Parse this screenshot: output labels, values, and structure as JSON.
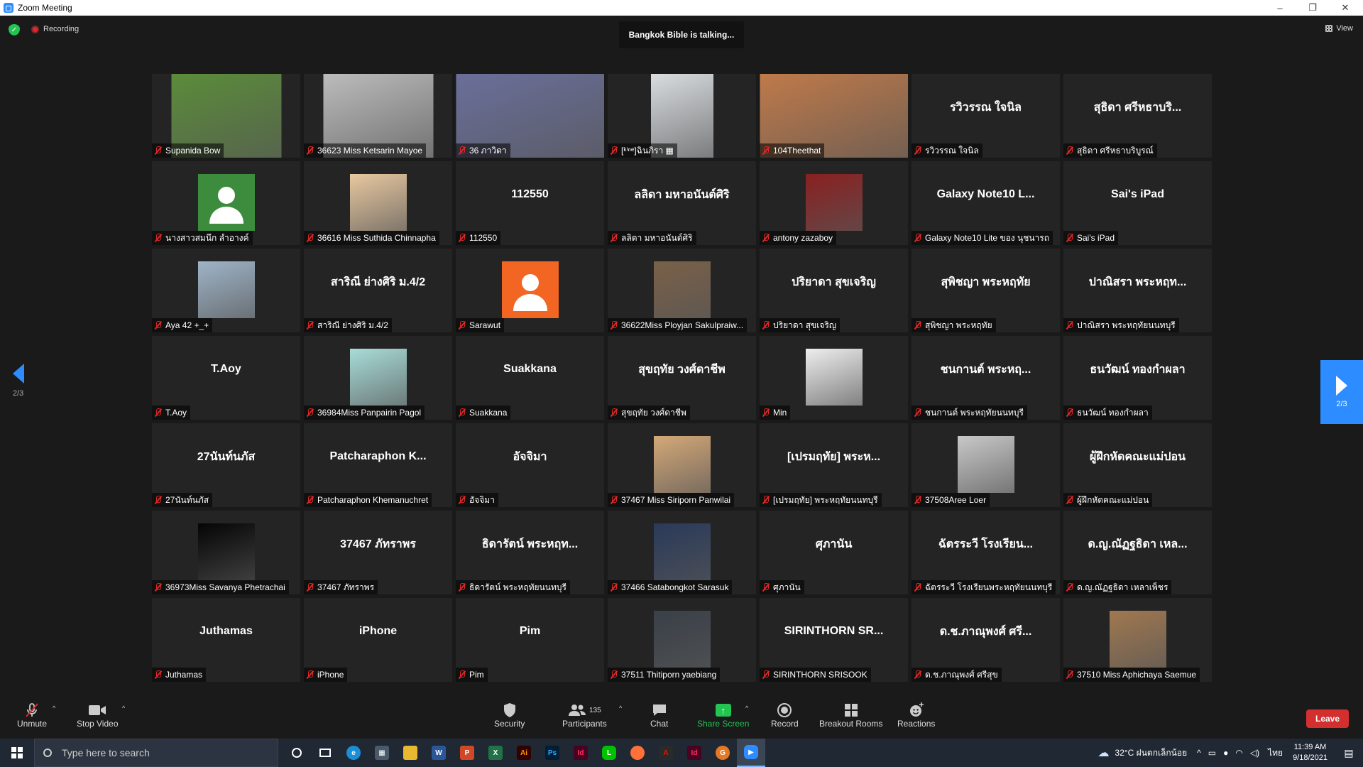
{
  "window": {
    "title": "Zoom Meeting",
    "min": "–",
    "max": "❐",
    "close": "✕"
  },
  "meeting": {
    "recording": "Recording",
    "talking": "Bangkok Bible is talking...",
    "view": "View",
    "page_left": "2/3",
    "page_right": "2/3"
  },
  "tiles": [
    {
      "label": "Supanida Bow",
      "kind": "photo",
      "color": "#5b8c3a"
    },
    {
      "label": "36623 Miss Ketsarin Mayoe",
      "kind": "photo",
      "color": "#bcbcbc"
    },
    {
      "label": "36 ภาวิดา",
      "kind": "photo-wide",
      "color": "#6a6f9a"
    },
    {
      "label": "[ᵏⁱⁿᵉ]ฉินภิรา ▦",
      "kind": "photo-mid",
      "color": "#d9dde0"
    },
    {
      "label": "104Theethat",
      "kind": "photo-wide",
      "color": "#c07a4a"
    },
    {
      "label": "รวิวรรณ ใจนิล",
      "kind": "name",
      "big": "รวิวรรณ ใจนิล"
    },
    {
      "label": "สุธิดา ศรีหธาบริบูรณ์",
      "kind": "name",
      "big": "สุธิดา ศรีหธาบริ..."
    },
    {
      "label": "นางสาวสมนึก ลำอางค์",
      "kind": "avatar",
      "color": "#3d8c3d"
    },
    {
      "label": "36616 Miss Suthida Chinnapha",
      "kind": "photo-sq",
      "color": "#e8c8a0"
    },
    {
      "label": "112550",
      "kind": "name",
      "big": "112550"
    },
    {
      "label": "ลลิดา มหาอนันต์ศิริ",
      "kind": "name",
      "big": "ลลิดา มหาอนันต์ศิริ"
    },
    {
      "label": "antony zazaboy",
      "kind": "photo-sq",
      "color": "#8a2020"
    },
    {
      "label": "Galaxy Note10 Lite ของ นุชนารถ",
      "kind": "name",
      "big": "Galaxy Note10 L..."
    },
    {
      "label": "Sai's iPad",
      "kind": "name",
      "big": "Sai's iPad"
    },
    {
      "label": "Aya 42 +_+",
      "kind": "photo-sq",
      "color": "#9fb4c8"
    },
    {
      "label": "สาริณี ย่างศิริ ม.4/2",
      "kind": "name",
      "big": "สาริณี ย่างศิริ ม.4/2"
    },
    {
      "label": "Sarawut",
      "kind": "avatar",
      "color": "#f26522"
    },
    {
      "label": "36622Miss Ployjan Sakulpraiw...",
      "kind": "photo-sq",
      "color": "#7a6048"
    },
    {
      "label": "ปริยาดา สุขเจริญ",
      "kind": "name",
      "big": "ปริยาดา สุขเจริญ"
    },
    {
      "label": "สุพิชญา พระหฤทัย",
      "kind": "name",
      "big": "สุพิชญา พระหฤทัย"
    },
    {
      "label": "ปาณิสรา พระหฤทัยนนทบุรี",
      "kind": "name",
      "big": "ปาณิสรา พระหฤท..."
    },
    {
      "label": "T.Aoy",
      "kind": "name",
      "big": "T.Aoy"
    },
    {
      "label": "36984Miss Panpairin Pagol",
      "kind": "photo-sq",
      "color": "#a8dcd8"
    },
    {
      "label": "Suakkana",
      "kind": "name",
      "big": "Suakkana"
    },
    {
      "label": "สุขฤทัย วงศ์ดาชีพ",
      "kind": "name",
      "big": "สุขฤทัย วงศ์ดาชีพ"
    },
    {
      "label": "Min",
      "kind": "photo-sq",
      "color": "#eeeeee"
    },
    {
      "label": "ชนกานต์ พระหฤทัยนนทบุรี",
      "kind": "name",
      "big": "ชนกานต์ พระหฤ..."
    },
    {
      "label": "ธนวัฒน์ ทองกำผลา",
      "kind": "name",
      "big": "ธนวัฒน์ ทองกำผลา"
    },
    {
      "label": "27นันท์นภัส",
      "kind": "name",
      "big": "27นันท์นภัส"
    },
    {
      "label": "Patcharaphon Khemanuchret",
      "kind": "name",
      "big": "Patcharaphon K..."
    },
    {
      "label": "อัจจิมา",
      "kind": "name",
      "big": "อัจจิมา"
    },
    {
      "label": "37467 Miss Siriporn Panwilai",
      "kind": "photo-sq",
      "color": "#d4a878"
    },
    {
      "label": "[เปรมฤทัย] พระหฤทัยนนทบุรี",
      "kind": "name",
      "big": "[เปรมฤทัย] พระห..."
    },
    {
      "label": "37508Aree Loer",
      "kind": "photo-sq",
      "color": "#c8c8c8"
    },
    {
      "label": "ผู้ฝึกหัดคณะแม่ปอน",
      "kind": "name",
      "big": "ผู้ฝึกหัดคณะแม่ปอน"
    },
    {
      "label": "36973Miss Savanya Phetrachai",
      "kind": "photo-sq",
      "color": "#050505"
    },
    {
      "label": "37467 ภัทราพร",
      "kind": "name",
      "big": "37467 ภัทราพร"
    },
    {
      "label": "ธิดารัตน์ พระหฤทัยนนทบุรี",
      "kind": "name",
      "big": "ธิดารัตน์ พระหฤท..."
    },
    {
      "label": "37466 Satabongkot Sarasuk",
      "kind": "photo-sq",
      "color": "#2a3a5a"
    },
    {
      "label": "ศุภานัน",
      "kind": "name",
      "big": "ศุภานัน"
    },
    {
      "label": "ฉัตรระวี โรงเรียนพระหฤทัยนนทบุรี",
      "kind": "name",
      "big": "ฉัตรระวี โรงเรียน..."
    },
    {
      "label": "ด.ญ.ณัฏฐธิดา เหลาเพ็ชร",
      "kind": "name",
      "big": "ด.ญ.ณัฏฐธิดา เหล..."
    },
    {
      "label": "Juthamas",
      "kind": "name",
      "big": "Juthamas"
    },
    {
      "label": "iPhone",
      "kind": "name",
      "big": "iPhone"
    },
    {
      "label": "Pim",
      "kind": "name",
      "big": "Pim"
    },
    {
      "label": "37511 Thitiporn yaebiang",
      "kind": "photo-sq",
      "color": "#3a4048"
    },
    {
      "label": "SIRINTHORN SRISOOK",
      "kind": "name",
      "big": "SIRINTHORN SR..."
    },
    {
      "label": "ด.ช.ภาณุพงศ์ ศรีสุข",
      "kind": "name",
      "big": "ด.ช.ภาณุพงศ์ ศรี..."
    },
    {
      "label": "37510 Miss Aphichaya Saemue",
      "kind": "photo-sq",
      "color": "#a07850"
    }
  ],
  "toolbar": {
    "unmute": "Unmute",
    "stop_video": "Stop Video",
    "security": "Security",
    "participants": "Participants",
    "participants_count": "135",
    "chat": "Chat",
    "share_screen": "Share Screen",
    "record": "Record",
    "breakout": "Breakout Rooms",
    "reactions": "Reactions",
    "leave": "Leave"
  },
  "taskbar": {
    "search_placeholder": "Type here to search",
    "weather": "32°C ฝนตกเล็กน้อย",
    "lang": "ไทย",
    "time": "11:39 AM",
    "date": "9/18/2021"
  },
  "colors": {
    "accent": "#2d8cff",
    "leave": "#d32f2f",
    "share": "#23c552",
    "muted": "#e02828"
  }
}
